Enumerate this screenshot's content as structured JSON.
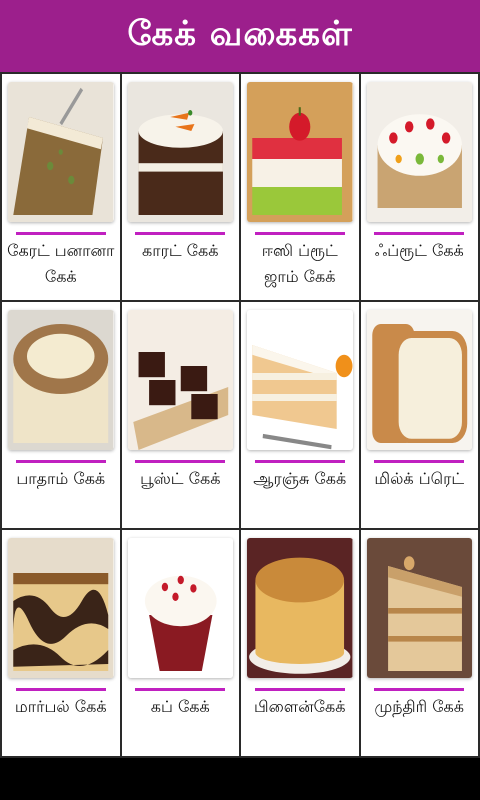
{
  "header": {
    "title": "கேக் வகைகள்"
  },
  "theme": {
    "header_bg": "#9c1f8c",
    "divider": "#c020c0"
  },
  "items": [
    {
      "label": "கேரட் பனானா கேக்",
      "image": "carrot-banana-cake"
    },
    {
      "label": "காரட் கேக்",
      "image": "carrot-cake"
    },
    {
      "label": "ஈஸி ப்ரூட் ஜாம் கேக்",
      "image": "fruit-jam-cake"
    },
    {
      "label": "ஃப்ரூட் கேக்",
      "image": "fruit-cake"
    },
    {
      "label": "பாதாம் கேக்",
      "image": "almond-cake"
    },
    {
      "label": "பூஸ்ட் கேக்",
      "image": "boost-cake"
    },
    {
      "label": "ஆரஞ்சு கேக்",
      "image": "orange-cake"
    },
    {
      "label": "மில்க் ப்ரெட்",
      "image": "milk-bread"
    },
    {
      "label": "மார்பல் கேக்",
      "image": "marble-cake"
    },
    {
      "label": "கப் கேக்",
      "image": "cup-cake"
    },
    {
      "label": "பிளைன்கேக்",
      "image": "plain-cake"
    },
    {
      "label": "முந்திரி கேக்",
      "image": "cashew-cake"
    }
  ]
}
